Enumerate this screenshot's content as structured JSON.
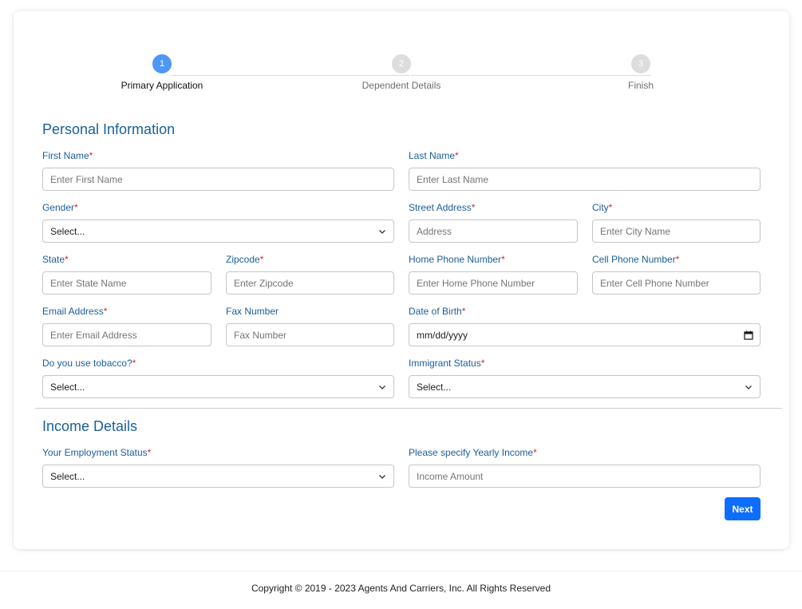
{
  "stepper": {
    "steps": [
      {
        "number": "1",
        "label": "Primary Application",
        "active": true
      },
      {
        "number": "2",
        "label": "Dependent Details",
        "active": false
      },
      {
        "number": "3",
        "label": "Finish",
        "active": false
      }
    ],
    "active_color": "#4f97f7",
    "inactive_color": "#dddddd"
  },
  "personal": {
    "title": "Personal Information",
    "first_name": {
      "label": "First Name",
      "placeholder": "Enter First Name"
    },
    "last_name": {
      "label": "Last Name",
      "placeholder": "Enter Last Name"
    },
    "gender": {
      "label": "Gender",
      "value": "Select..."
    },
    "street": {
      "label": "Street Address",
      "placeholder": "Address"
    },
    "city": {
      "label": "City",
      "placeholder": "Enter City Name"
    },
    "state": {
      "label": "State",
      "placeholder": "Enter State Name"
    },
    "zipcode": {
      "label": "Zipcode",
      "placeholder": "Enter Zipcode"
    },
    "home_phone": {
      "label": "Home Phone Number",
      "placeholder": "Enter Home Phone Number"
    },
    "cell_phone": {
      "label": "Cell Phone Number",
      "placeholder": "Enter Cell Phone Number"
    },
    "email": {
      "label": "Email Address",
      "placeholder": "Enter Email Address"
    },
    "fax": {
      "label": "Fax Number",
      "placeholder": "Fax Number"
    },
    "dob": {
      "label": "Date of Birth",
      "value": "mm/dd/yyyy"
    },
    "tobacco": {
      "label": "Do you use tobacco?",
      "value": "Select..."
    },
    "immigrant": {
      "label": "Immigrant Status",
      "value": "Select..."
    }
  },
  "income": {
    "title": "Income Details",
    "employment": {
      "label": "Your Employment Status",
      "value": "Select..."
    },
    "yearly_income": {
      "label": "Please specify Yearly Income",
      "placeholder": "Income Amount"
    }
  },
  "required_marker": "*",
  "next_button": "Next",
  "footer": "Copyright © 2019 - 2023 Agents And Carriers, Inc. All Rights Reserved",
  "colors": {
    "label": "#1a5e99",
    "required": "#d9262c",
    "primary_button": "#0d6efd"
  }
}
